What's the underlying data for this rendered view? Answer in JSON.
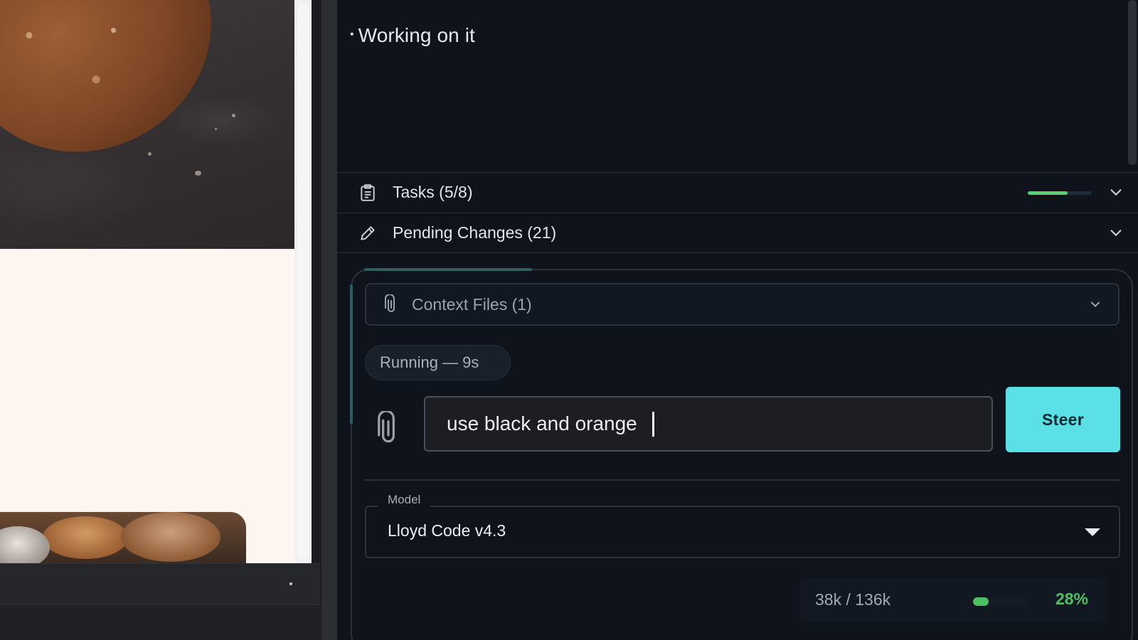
{
  "chat": {
    "last_message": "Working on it"
  },
  "tasks": {
    "label": "Tasks (5/8)",
    "icon": "clipboard-icon",
    "progress_fraction": 0.625
  },
  "pending_changes": {
    "label": "Pending Changes (21)",
    "icon": "pencil-icon"
  },
  "context_files": {
    "label": "Context Files (1)",
    "icon": "paperclip-icon"
  },
  "run_status": {
    "label": "Running — 9s"
  },
  "composer": {
    "input_value": "use black and orange",
    "steer_label": "Steer",
    "attach_icon": "paperclip-icon"
  },
  "model": {
    "legend": "Model",
    "selected": "Lloyd Code v4.3"
  },
  "tokens": {
    "count": "38k / 136k",
    "percent": "28%",
    "fraction": 0.28
  },
  "colors": {
    "accent": "#5be0e6",
    "progress_green": "#59cf73",
    "panel_bg": "#0f141c"
  }
}
